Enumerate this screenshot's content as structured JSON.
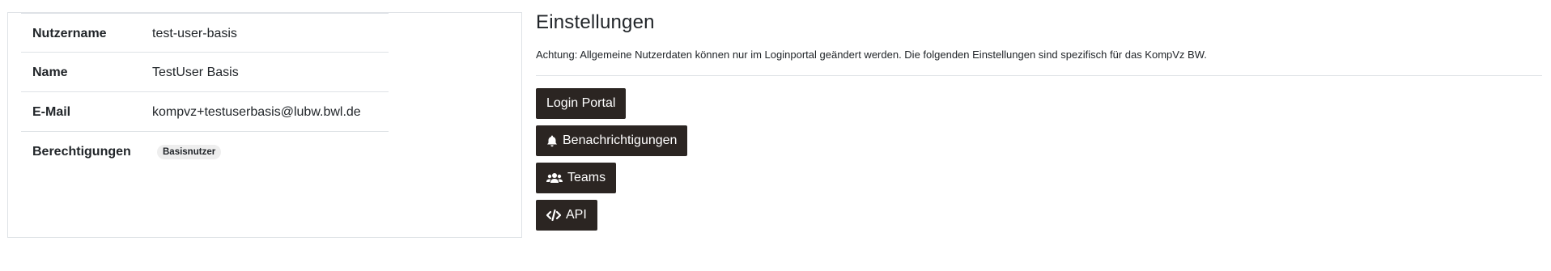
{
  "profile": {
    "rows": [
      {
        "label": "Nutzername",
        "value": "test-user-basis"
      },
      {
        "label": "Name",
        "value": "TestUser Basis"
      },
      {
        "label": "E-Mail",
        "value": "kompvz+testuserbasis@lubw.bwl.de"
      },
      {
        "label": "Berechtigungen",
        "badge": "Basisnutzer"
      }
    ]
  },
  "settings": {
    "title": "Einstellungen",
    "note": "Achtung: Allgemeine Nutzerdaten können nur im Loginportal geändert werden. Die folgenden Einstellungen sind spezifisch für das KompVz BW.",
    "buttons": {
      "login_portal": "Login Portal",
      "notifications": "Benachrichtigungen",
      "teams": "Teams",
      "api": "API"
    },
    "icons": {
      "notifications": "bell-icon",
      "teams": "users-icon",
      "api": "code-icon"
    },
    "button_color": "#2b2522"
  }
}
